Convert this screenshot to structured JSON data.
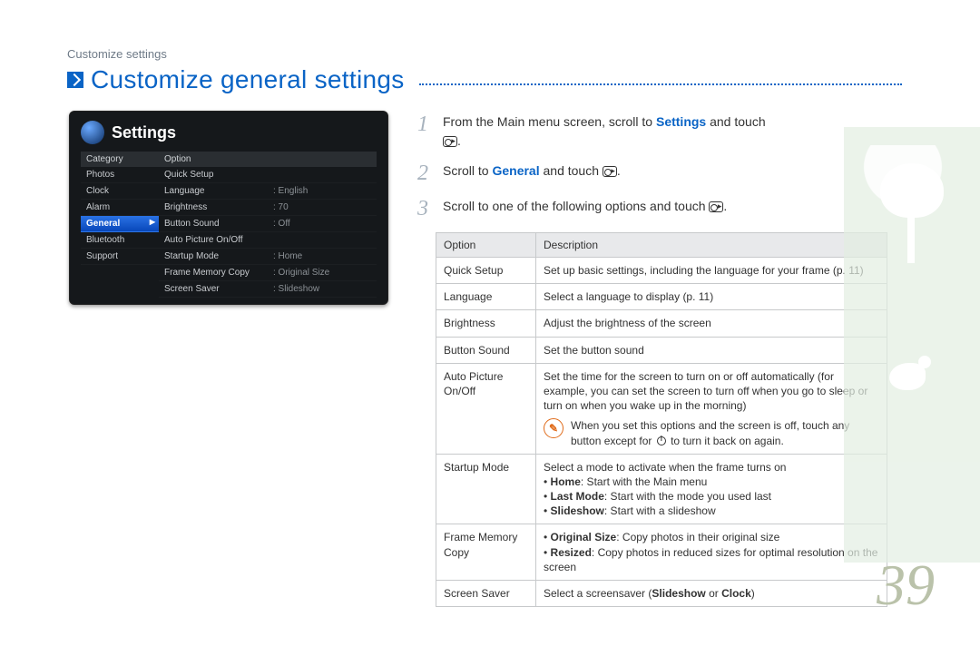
{
  "page_header": "Customize settings",
  "title": "Customize general settings",
  "page_number": "39",
  "screen": {
    "title": "Settings",
    "cat_header": "Category",
    "opt_header": "Option",
    "categories": [
      "Photos",
      "Clock",
      "Alarm",
      "General",
      "Bluetooth",
      "Support"
    ],
    "selected_index": 3,
    "options": [
      {
        "label": "Quick Setup",
        "value": ""
      },
      {
        "label": "Language",
        "value": ": English"
      },
      {
        "label": "Brightness",
        "value": ": 70"
      },
      {
        "label": "Button Sound",
        "value": ": Off"
      },
      {
        "label": "Auto Picture On/Off",
        "value": ""
      },
      {
        "label": "Startup Mode",
        "value": ": Home"
      },
      {
        "label": "Frame Memory Copy",
        "value": ": Original Size"
      },
      {
        "label": "Screen Saver",
        "value": ": Slideshow"
      }
    ]
  },
  "steps": {
    "s1_pre": "From the Main menu screen, scroll to ",
    "s1_bold": "Settings",
    "s1_post": " and touch",
    "s2_pre": "Scroll to ",
    "s2_bold": "General",
    "s2_post": " and touch ",
    "s3": "Scroll to one of the following options and touch "
  },
  "table": {
    "h1": "Option",
    "h2": "Description",
    "rows": {
      "quick_setup": {
        "opt": "Quick Setup",
        "desc": "Set up basic settings, including the language for your frame (p. 11)"
      },
      "language": {
        "opt": "Language",
        "desc": "Select a language to display (p. 11)"
      },
      "brightness": {
        "opt": "Brightness",
        "desc": "Adjust the brightness of the screen"
      },
      "button_sound": {
        "opt": "Button Sound",
        "desc": "Set the button sound"
      },
      "auto_pic": {
        "opt": "Auto Picture On/Off",
        "desc": "Set the time for the screen to turn on or off automatically (for example, you can set the screen to turn off when you go to sleep or turn on when you wake up in the morning)",
        "note_pre": "When you set this options and the screen is off, touch any button except for ",
        "note_post": " to turn it back on again."
      },
      "startup": {
        "opt": "Startup Mode",
        "intro": "Select a mode to activate when the frame turns on",
        "b1_label": "Home",
        "b1_text": ": Start with the Main menu",
        "b2_label": "Last Mode",
        "b2_text": ": Start with the mode you used last",
        "b3_label": "Slideshow",
        "b3_text": ": Start with a slideshow"
      },
      "frame_copy": {
        "opt": "Frame Memory Copy",
        "b1_label": "Original Size",
        "b1_text": ": Copy photos in their original size",
        "b2_label": "Resized",
        "b2_text": ": Copy photos in reduced sizes for optimal resolution on the screen"
      },
      "screen_saver": {
        "opt": "Screen Saver",
        "pre": "Select a screensaver (",
        "b1": "Slideshow",
        "mid": " or ",
        "b2": "Clock",
        "post": ")"
      }
    }
  }
}
